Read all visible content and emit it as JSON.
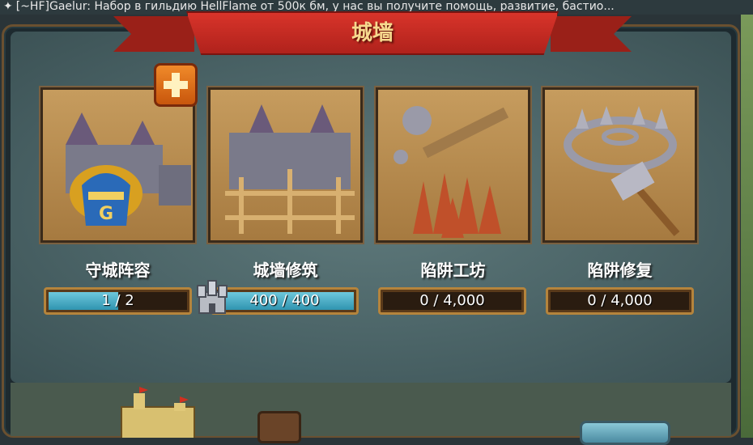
{
  "top_bar": {
    "sender": "[~HF]Gaelur",
    "message": ": Набор в гильдию HellFlame от 500к бм, у нас вы получите помощь, развитие, бастио..."
  },
  "title": "城墙",
  "cards": [
    {
      "label": "守城阵容",
      "value": "1 / 2",
      "progress": 0.5
    },
    {
      "label": "城墙修筑",
      "value": "400 / 400",
      "progress": 1.0
    },
    {
      "label": "陷阱工坊",
      "value": "0 / 4,000",
      "progress": 0.0
    },
    {
      "label": "陷阱修复",
      "value": "0 / 4,000",
      "progress": 0.0
    }
  ],
  "colors": {
    "banner": "#c42a22",
    "title_text": "#f6d98e",
    "progress_fill": "#4fb0c8",
    "bar_border": "#b5843c",
    "plus_button": "#e8781c"
  },
  "icons": {
    "plus_button": "plus-icon",
    "castle_badge": "castle-icon"
  }
}
